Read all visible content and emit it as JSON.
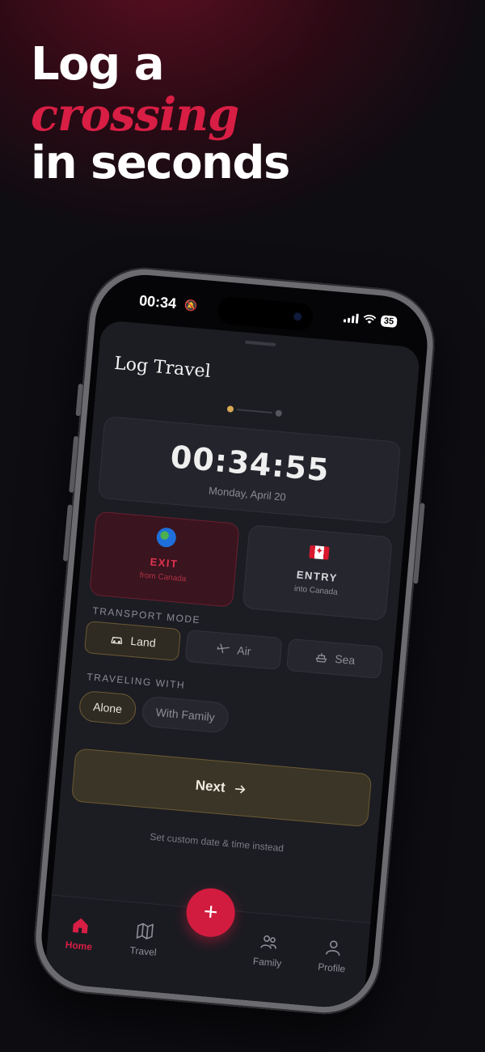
{
  "headline": {
    "line1": "Log a",
    "line2": "crossing",
    "line3": "in seconds"
  },
  "status_bar": {
    "time": "00:34",
    "battery": "35"
  },
  "sheet": {
    "title": "Log Travel",
    "clock": "00:34:55",
    "date": "Monday, April 20",
    "exit": {
      "label": "EXIT",
      "sub": "from Canada",
      "icon": "globe-icon"
    },
    "entry": {
      "label": "ENTRY",
      "sub": "into Canada",
      "icon": "canada-flag-icon"
    },
    "transport_label": "TRANSPORT MODE",
    "transport": [
      {
        "label": "Land",
        "icon": "car-icon",
        "selected": true
      },
      {
        "label": "Air",
        "icon": "plane-icon",
        "selected": false
      },
      {
        "label": "Sea",
        "icon": "ship-icon",
        "selected": false
      }
    ],
    "traveling_label": "TRAVELING WITH",
    "traveling": [
      {
        "label": "Alone",
        "selected": true
      },
      {
        "label": "With Family",
        "selected": false
      }
    ],
    "next_label": "Next",
    "custom_link": "Set custom date & time instead"
  },
  "tabs": [
    {
      "label": "Home",
      "icon": "home-icon",
      "active": true
    },
    {
      "label": "Travel",
      "icon": "map-icon",
      "active": false
    },
    {
      "label": "Family",
      "icon": "people-icon",
      "active": false
    },
    {
      "label": "Profile",
      "icon": "person-icon",
      "active": false
    }
  ],
  "fab_label": "+",
  "colors": {
    "accent": "#d81e44",
    "gold": "#d9a855",
    "background": "#0d0d12",
    "sheet": "#1c1d23"
  }
}
